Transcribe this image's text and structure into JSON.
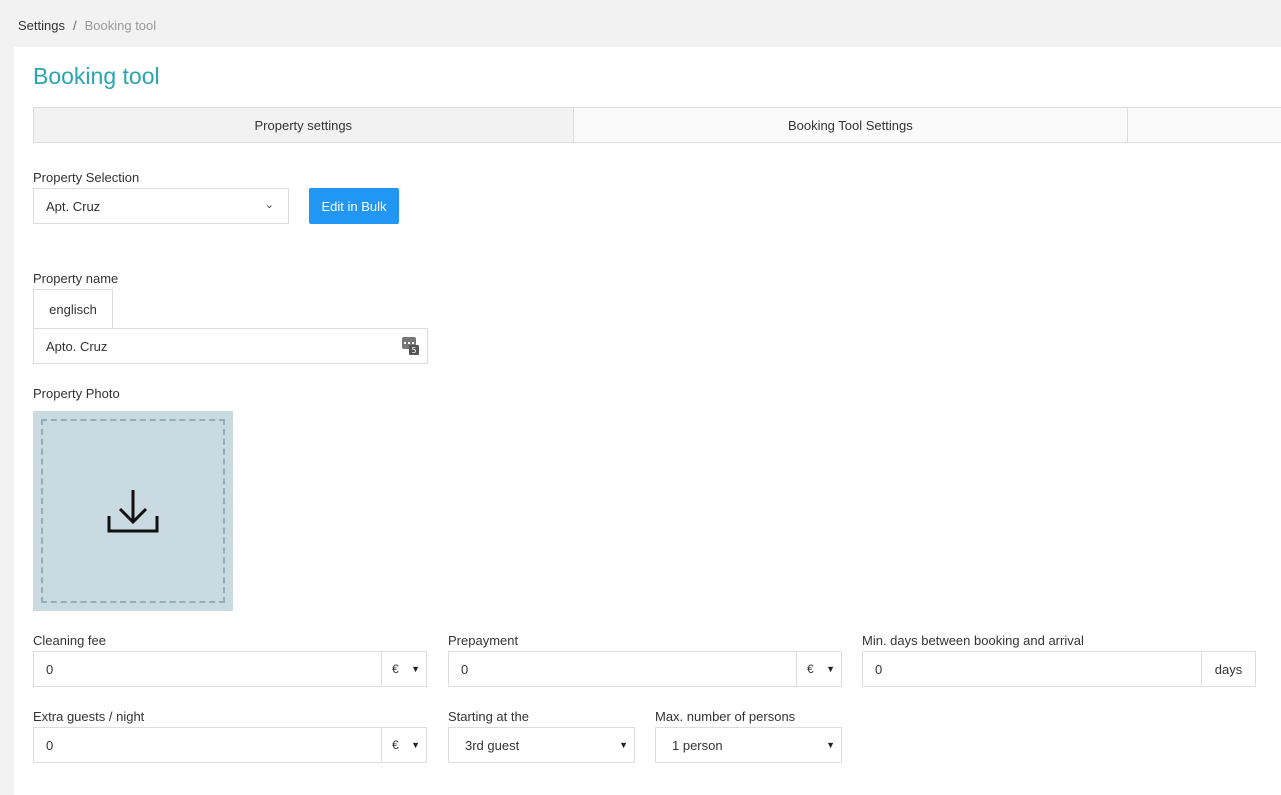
{
  "breadcrumb": {
    "parent": "Settings",
    "separator": "/",
    "current": "Booking tool"
  },
  "page": {
    "title": "Booking tool"
  },
  "tabs": [
    {
      "label": "Property settings",
      "active": true
    },
    {
      "label": "Booking Tool Settings",
      "active": false
    },
    {
      "label": "",
      "active": false
    }
  ],
  "property_selection": {
    "label": "Property Selection",
    "value": "Apt. Cruz",
    "chevron": "⌄"
  },
  "bulk": {
    "label": "Edit in Bulk"
  },
  "property_name": {
    "label": "Property name",
    "language_tab": "englisch",
    "value": "Apto. Cruz",
    "icon": "translate-icon"
  },
  "photo": {
    "label": "Property Photo",
    "icon": "download-icon"
  },
  "cleaning_fee": {
    "label": "Cleaning fee",
    "value": "0",
    "currency": "€"
  },
  "prepayment": {
    "label": "Prepayment",
    "value": "0",
    "currency": "€"
  },
  "min_days": {
    "label": "Min. days between booking and arrival",
    "value": "0",
    "unit": "days"
  },
  "extra_guests": {
    "label": "Extra guests / night",
    "value": "0",
    "currency": "€"
  },
  "starting_at": {
    "label": "Starting at the",
    "value": "3rd guest"
  },
  "max_persons": {
    "label": "Max. number of persons",
    "value": "1 person"
  },
  "colors": {
    "accent": "#2aa5b0",
    "button": "#2196f3",
    "photo_bg": "#c9dbe1"
  }
}
